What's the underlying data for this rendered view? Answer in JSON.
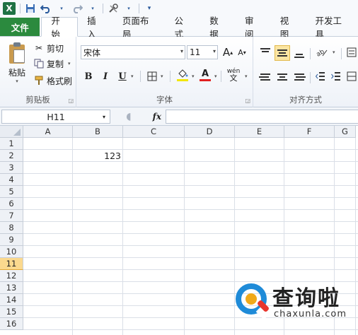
{
  "qat": {
    "logo": "X",
    "save_icon": "save-icon",
    "undo_icon": "undo-icon",
    "redo_icon": "redo-icon",
    "customize_icon": "customize-icon"
  },
  "tabs": [
    {
      "label": "文件"
    },
    {
      "label": "开始"
    },
    {
      "label": "插入"
    },
    {
      "label": "页面布局"
    },
    {
      "label": "公式"
    },
    {
      "label": "数据"
    },
    {
      "label": "审阅"
    },
    {
      "label": "视图"
    },
    {
      "label": "开发工具"
    }
  ],
  "ribbon": {
    "clipboard": {
      "label": "剪贴板",
      "paste": "粘贴",
      "cut": "剪切",
      "copy": "复制",
      "format_painter": "格式刷"
    },
    "font": {
      "label": "字体",
      "font_name": "宋体",
      "font_size": "11",
      "bold": "B",
      "italic": "I",
      "underline": "U",
      "grow": "A",
      "shrink": "A",
      "font_color": "A",
      "phonetic": "wén"
    },
    "alignment": {
      "label": "对齐方式"
    }
  },
  "formula_bar": {
    "name_box": "H11",
    "fx": "fx",
    "value": ""
  },
  "grid": {
    "columns": [
      "A",
      "B",
      "C",
      "D",
      "E",
      "F",
      "G"
    ],
    "rows": [
      "1",
      "2",
      "3",
      "4",
      "5",
      "6",
      "7",
      "8",
      "9",
      "10",
      "11",
      "12",
      "13",
      "14",
      "15",
      "16"
    ],
    "selected_row": "11",
    "cells": {
      "B2": "123"
    }
  },
  "watermark": {
    "title": "查询啦",
    "site": "chaxunla.com"
  },
  "colors": {
    "file_tab": "#2b8a3e",
    "selection_row_header": "#fbd98e",
    "watermark_blue": "#1f8bd8",
    "watermark_red": "#e8352d",
    "watermark_orange": "#f0a91a"
  }
}
